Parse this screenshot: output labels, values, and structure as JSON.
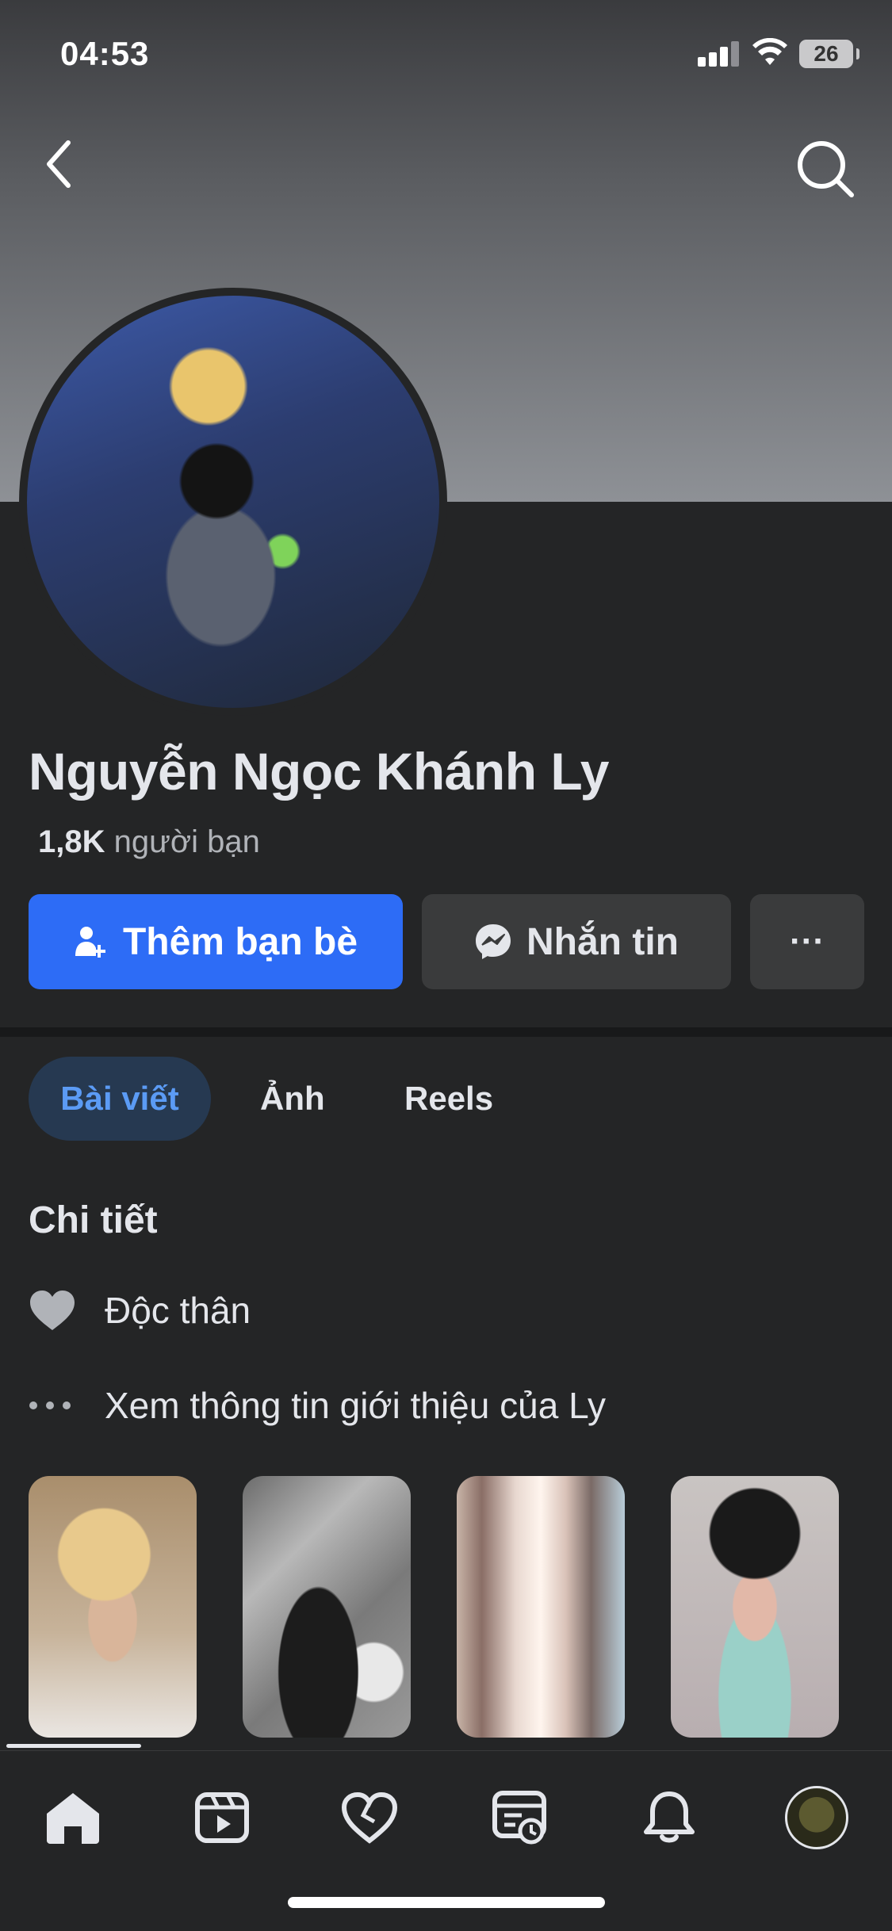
{
  "status_bar": {
    "time": "04:53",
    "battery": "26"
  },
  "profile": {
    "name": "Nguyễn Ngọc Khánh Ly",
    "friends_count": "1,8K",
    "friends_label": "người bạn"
  },
  "actions": {
    "add_friend": "Thêm bạn bè",
    "message": "Nhắn tin",
    "more": "···"
  },
  "tabs": [
    {
      "label": "Bài viết",
      "active": true
    },
    {
      "label": "Ảnh",
      "active": false
    },
    {
      "label": "Reels",
      "active": false
    }
  ],
  "details": {
    "title": "Chi tiết",
    "items": [
      {
        "icon": "heart-icon",
        "text": "Độc thân"
      },
      {
        "icon": "more-dots-icon",
        "text": "Xem thông tin giới thiệu của Ly"
      }
    ]
  },
  "bottom_nav": [
    {
      "icon": "home-icon",
      "active": true
    },
    {
      "icon": "video-icon"
    },
    {
      "icon": "dating-heart-icon"
    },
    {
      "icon": "feeds-icon"
    },
    {
      "icon": "bell-icon"
    },
    {
      "icon": "profile-avatar"
    }
  ],
  "colors": {
    "accent": "#2d6cf6",
    "background": "#242526",
    "tab_active_bg": "#263951",
    "tab_active_text": "#5b9bf5"
  }
}
